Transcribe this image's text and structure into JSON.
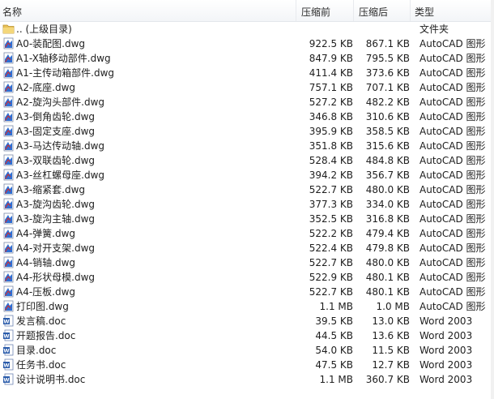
{
  "columns": {
    "name": "名称",
    "before": "压缩前",
    "after": "压缩后",
    "type": "类型"
  },
  "colors": {
    "folder": "#e8c15a",
    "autocad": "#1f5fbf",
    "word": "#2b5cab",
    "header_bg": "#f6f7f9",
    "row_hover": "#e5f3fb"
  },
  "files": [
    {
      "name": ".. (上级目录)",
      "before": "",
      "after": "",
      "type": "文件夹",
      "icon": "folder-icon"
    },
    {
      "name": "A0-装配图.dwg",
      "before": "922.5 KB",
      "after": "867.1 KB",
      "type": "AutoCAD 图形",
      "icon": "dwg-icon"
    },
    {
      "name": "A1-X轴移动部件.dwg",
      "before": "847.9 KB",
      "after": "795.5 KB",
      "type": "AutoCAD 图形",
      "icon": "dwg-icon"
    },
    {
      "name": "A1-主传动箱部件.dwg",
      "before": "411.4 KB",
      "after": "373.6 KB",
      "type": "AutoCAD 图形",
      "icon": "dwg-icon"
    },
    {
      "name": "A2-底座.dwg",
      "before": "757.1 KB",
      "after": "707.1 KB",
      "type": "AutoCAD 图形",
      "icon": "dwg-icon"
    },
    {
      "name": "A2-旋沟头部件.dwg",
      "before": "527.2 KB",
      "after": "482.2 KB",
      "type": "AutoCAD 图形",
      "icon": "dwg-icon"
    },
    {
      "name": "A3-倒角齿轮.dwg",
      "before": "346.8 KB",
      "after": "310.6 KB",
      "type": "AutoCAD 图形",
      "icon": "dwg-icon"
    },
    {
      "name": "A3-固定支座.dwg",
      "before": "395.9 KB",
      "after": "358.5 KB",
      "type": "AutoCAD 图形",
      "icon": "dwg-icon"
    },
    {
      "name": "A3-马达传动轴.dwg",
      "before": "351.8 KB",
      "after": "315.6 KB",
      "type": "AutoCAD 图形",
      "icon": "dwg-icon"
    },
    {
      "name": "A3-双联齿轮.dwg",
      "before": "528.4 KB",
      "after": "484.8 KB",
      "type": "AutoCAD 图形",
      "icon": "dwg-icon"
    },
    {
      "name": "A3-丝杠螺母座.dwg",
      "before": "394.2 KB",
      "after": "356.7 KB",
      "type": "AutoCAD 图形",
      "icon": "dwg-icon"
    },
    {
      "name": "A3-缩紧套.dwg",
      "before": "522.7 KB",
      "after": "480.0 KB",
      "type": "AutoCAD 图形",
      "icon": "dwg-icon"
    },
    {
      "name": "A3-旋沟齿轮.dwg",
      "before": "377.3 KB",
      "after": "334.0 KB",
      "type": "AutoCAD 图形",
      "icon": "dwg-icon"
    },
    {
      "name": "A3-旋沟主轴.dwg",
      "before": "352.5 KB",
      "after": "316.8 KB",
      "type": "AutoCAD 图形",
      "icon": "dwg-icon"
    },
    {
      "name": "A4-弹簧.dwg",
      "before": "522.2 KB",
      "after": "479.4 KB",
      "type": "AutoCAD 图形",
      "icon": "dwg-icon"
    },
    {
      "name": "A4-对开支架.dwg",
      "before": "522.4 KB",
      "after": "479.8 KB",
      "type": "AutoCAD 图形",
      "icon": "dwg-icon"
    },
    {
      "name": "A4-销轴.dwg",
      "before": "522.7 KB",
      "after": "480.0 KB",
      "type": "AutoCAD 图形",
      "icon": "dwg-icon"
    },
    {
      "name": "A4-形状母模.dwg",
      "before": "522.9 KB",
      "after": "480.1 KB",
      "type": "AutoCAD 图形",
      "icon": "dwg-icon"
    },
    {
      "name": "A4-压板.dwg",
      "before": "522.7 KB",
      "after": "480.1 KB",
      "type": "AutoCAD 图形",
      "icon": "dwg-icon"
    },
    {
      "name": "打印图.dwg",
      "before": "1.1 MB",
      "after": "1.0 MB",
      "type": "AutoCAD 图形",
      "icon": "dwg-icon"
    },
    {
      "name": "发言稿.doc",
      "before": "39.5 KB",
      "after": "13.0 KB",
      "type": "Word 2003",
      "icon": "doc-icon"
    },
    {
      "name": "开题报告.doc",
      "before": "44.5 KB",
      "after": "13.6 KB",
      "type": "Word 2003",
      "icon": "doc-icon"
    },
    {
      "name": "目录.doc",
      "before": "54.0 KB",
      "after": "11.5 KB",
      "type": "Word 2003",
      "icon": "doc-icon"
    },
    {
      "name": "任务书.doc",
      "before": "47.5 KB",
      "after": "12.7 KB",
      "type": "Word 2003",
      "icon": "doc-icon"
    },
    {
      "name": "设计说明书.doc",
      "before": "1.1 MB",
      "after": "360.7 KB",
      "type": "Word 2003",
      "icon": "doc-icon"
    }
  ]
}
